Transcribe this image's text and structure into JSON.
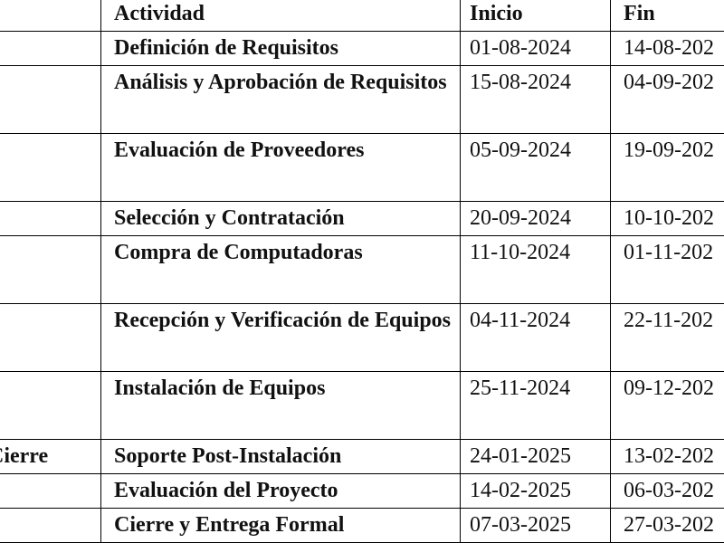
{
  "table": {
    "headers": {
      "phase": "",
      "activity": "Actividad",
      "start": "Inicio",
      "end": "Fin"
    },
    "rows": [
      {
        "phase": "",
        "activity": "Definición de Requisitos",
        "start": "01-08-2024",
        "end": "14-08-202"
      },
      {
        "phase": "",
        "activity": "Análisis y Aprobación de Requisitos",
        "start": "15-08-2024",
        "end": "04-09-202"
      },
      {
        "phase": "",
        "activity": "Evaluación de Proveedores",
        "start": "05-09-2024",
        "end": "19-09-202"
      },
      {
        "phase": "",
        "activity": "Selección y Contratación",
        "start": "20-09-2024",
        "end": "10-10-202"
      },
      {
        "phase": "",
        "activity": "Compra de Computadoras",
        "start": "11-10-2024",
        "end": "01-11-202"
      },
      {
        "phase": "",
        "activity": "Recepción y Verificación de Equipos",
        "start": "04-11-2024",
        "end": "22-11-202"
      },
      {
        "phase": "",
        "activity": "Instalación de Equipos",
        "start": "25-11-2024",
        "end": "09-12-202"
      },
      {
        "phase": "Cierre",
        "activity": "Soporte Post-Instalación",
        "start": "24-01-2025",
        "end": "13-02-202"
      },
      {
        "phase": "",
        "activity": "Evaluación del Proyecto",
        "start": "14-02-2025",
        "end": "06-03-202"
      },
      {
        "phase": "",
        "activity": "Cierre y Entrega Formal",
        "start": "07-03-2025",
        "end": "27-03-202"
      }
    ]
  }
}
